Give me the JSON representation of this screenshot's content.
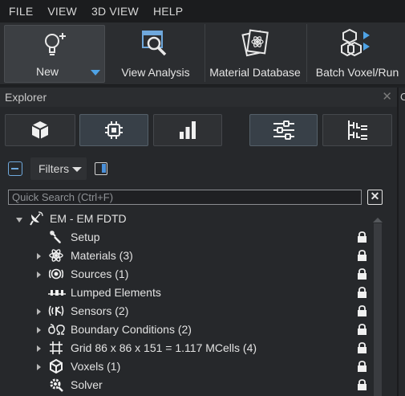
{
  "menu": [
    "FILE",
    "VIEW",
    "3D VIEW",
    "HELP"
  ],
  "toolbar": {
    "new_label": "New",
    "view_analysis_label": "View Analysis",
    "material_database_label": "Material Database",
    "batch_label": "Batch Voxel/Run"
  },
  "explorer": {
    "title": "Explorer",
    "close_glyph": "✕",
    "right_panel_glyph": "C",
    "filters_label": "Filters",
    "search_placeholder": "Quick Search (Ctrl+F)",
    "clear_glyph": "✕",
    "view_buttons": [
      "cube-icon",
      "chip-icon",
      "bar-chart-icon",
      "sliders-icon",
      "hierarchy-icon"
    ],
    "active_view_buttons": [
      "chip-icon",
      "sliders-icon"
    ]
  },
  "tree": {
    "root": {
      "label": "EM - EM FDTD",
      "icon": "satellite-dish-icon"
    },
    "items": [
      {
        "label": "Setup",
        "icon": "wrench-icon",
        "expandable": false
      },
      {
        "label": "Materials (3)",
        "icon": "atom-icon",
        "expandable": true
      },
      {
        "label": "Sources (1)",
        "icon": "radiating-source-icon",
        "expandable": true
      },
      {
        "label": "Lumped Elements",
        "icon": "lumped-element-icon",
        "expandable": false
      },
      {
        "label": "Sensors (2)",
        "icon": "sensor-icon",
        "expandable": true
      },
      {
        "label": "Boundary Conditions (2)",
        "icon": "boundary-conditions-icon",
        "expandable": true
      },
      {
        "label": "Grid 86 x 86 x 151 = 1.117 MCells (4)",
        "icon": "grid-icon",
        "expandable": true
      },
      {
        "label": "Voxels (1)",
        "icon": "voxel-cube-icon",
        "expandable": true
      },
      {
        "label": "Solver",
        "icon": "solver-gear-icon",
        "expandable": false
      }
    ]
  },
  "colors": {
    "background": "#26282b",
    "accent": "#4a90d9",
    "active_button": "#384048"
  }
}
